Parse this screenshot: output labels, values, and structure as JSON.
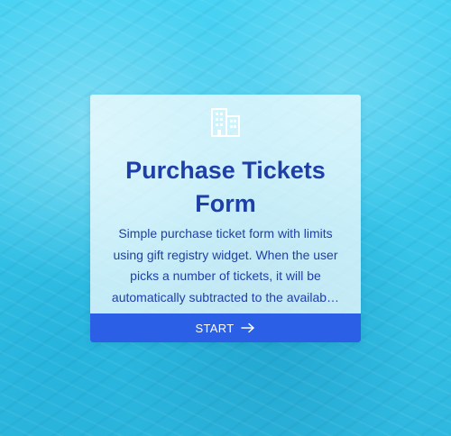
{
  "background": {
    "description_icon": "water-background",
    "accent_color": "#40cdf0"
  },
  "card": {
    "icon": "building-icon",
    "title": "Purchase Tickets Form",
    "description": "Simple purchase ticket form with limits using gift registry widget. When the user picks a number of tickets, it will be automatically subtracted to the availab…",
    "start_button": {
      "label": "START",
      "icon": "arrow-right-icon",
      "color": "#2a5fe6"
    },
    "text_color": "#1f3fa8"
  }
}
